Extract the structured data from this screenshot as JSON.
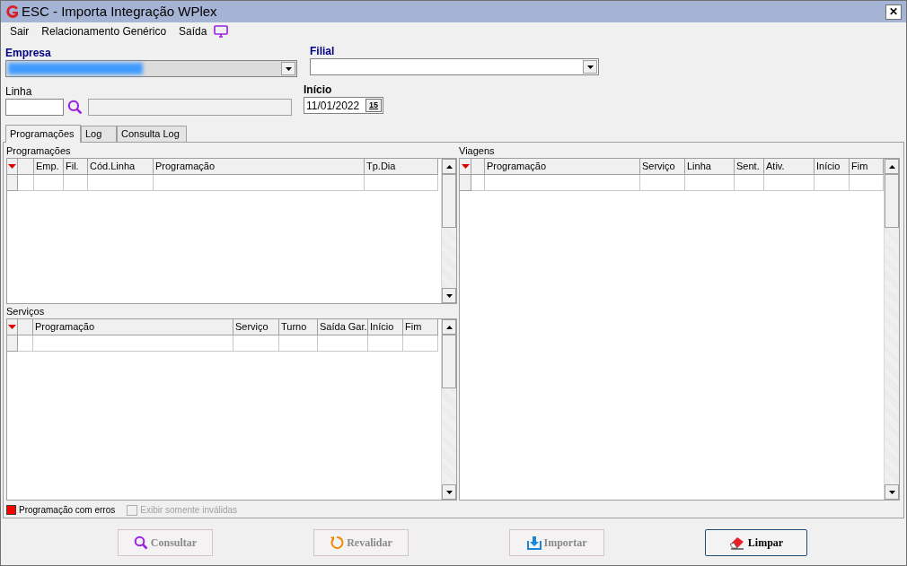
{
  "window": {
    "title": "ESC - Importa Integração WPlex",
    "close": "✕"
  },
  "menu": [
    "Sair",
    "Relacionamento Genérico",
    "Saída"
  ],
  "empresa": {
    "label": "Empresa",
    "redacted": true
  },
  "filial": {
    "label": "Filial"
  },
  "linha": {
    "label": "Linha"
  },
  "inicio": {
    "label": "Início",
    "value": "11/01/2022",
    "calendar": "15"
  },
  "tabs": [
    {
      "label": "Programações",
      "selected": true
    },
    {
      "label": "Log",
      "selected": false
    },
    {
      "label": "Consulta Log",
      "selected": false
    }
  ],
  "programacoes": {
    "title": "Programações",
    "columns": [
      "Emp.",
      "Fil.",
      "Cód.Linha",
      "Programação",
      "Tp.Dia"
    ]
  },
  "servicos": {
    "title": "Serviços",
    "columns": [
      "Programação",
      "Serviço",
      "Turno",
      "Saída Gar.",
      "Início",
      "Fim"
    ]
  },
  "viagens": {
    "title": "Viagens",
    "columns": [
      "Programação",
      "Serviço",
      "Linha",
      "Sent.",
      "Ativ.",
      "Início",
      "Fim"
    ]
  },
  "legend": {
    "label": "Programação com erros",
    "color": "#ff0000"
  },
  "only_invalid": {
    "label": "Exibir somente inválidas",
    "checked": false,
    "disabled": true
  },
  "buttons": [
    {
      "kind": "search",
      "label": "Consultar",
      "disabled": true
    },
    {
      "kind": "revalidate",
      "label": "Revalidar",
      "disabled": true
    },
    {
      "kind": "import",
      "label": "Importar",
      "disabled": true
    },
    {
      "kind": "clear",
      "label": "Limpar",
      "disabled": false
    }
  ]
}
